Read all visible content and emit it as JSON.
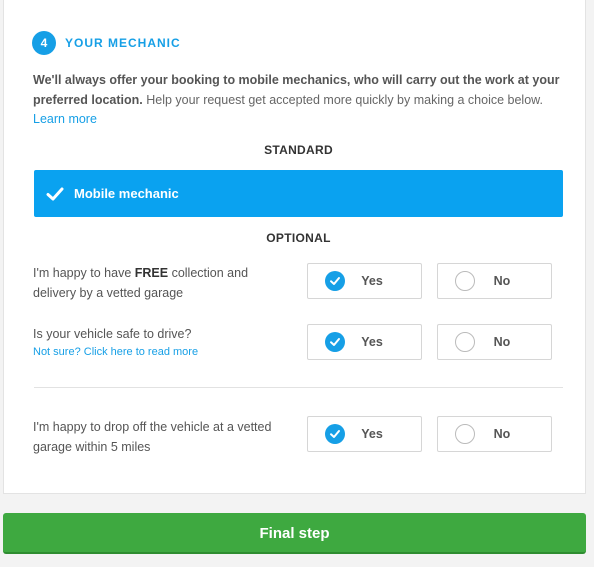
{
  "step": {
    "number": "4",
    "title": "YOUR MECHANIC"
  },
  "intro": {
    "bold": "We'll always offer your booking to mobile mechanics, who will carry out the work at your preferred location.",
    "text": " Help your request get accepted more quickly by making a choice below. ",
    "link": "Learn more"
  },
  "standard": {
    "label": "STANDARD",
    "option": "Mobile mechanic",
    "icon": "checkmark-icon"
  },
  "optional": {
    "label": "OPTIONAL"
  },
  "questions": [
    {
      "text_before": "I'm happy to have ",
      "text_bold": "FREE",
      "text_after": " collection and delivery by a vetted garage",
      "sub": "",
      "yes": "Yes",
      "no": "No",
      "selected": "yes"
    },
    {
      "text_before": "Is your vehicle safe to drive?",
      "text_bold": "",
      "text_after": "",
      "sub": "Not sure? Click here to read more",
      "yes": "Yes",
      "no": "No",
      "selected": "yes"
    },
    {
      "text_before": "I'm happy to drop off the vehicle at a vetted garage within 5 miles",
      "text_bold": "",
      "text_after": "",
      "sub": "",
      "yes": "Yes",
      "no": "No",
      "selected": "yes"
    }
  ],
  "final": {
    "label": "Final step"
  },
  "colors": {
    "accent": "#169fe6",
    "primary_button": "#3ea940",
    "selected_bar": "#0aa2f0"
  }
}
